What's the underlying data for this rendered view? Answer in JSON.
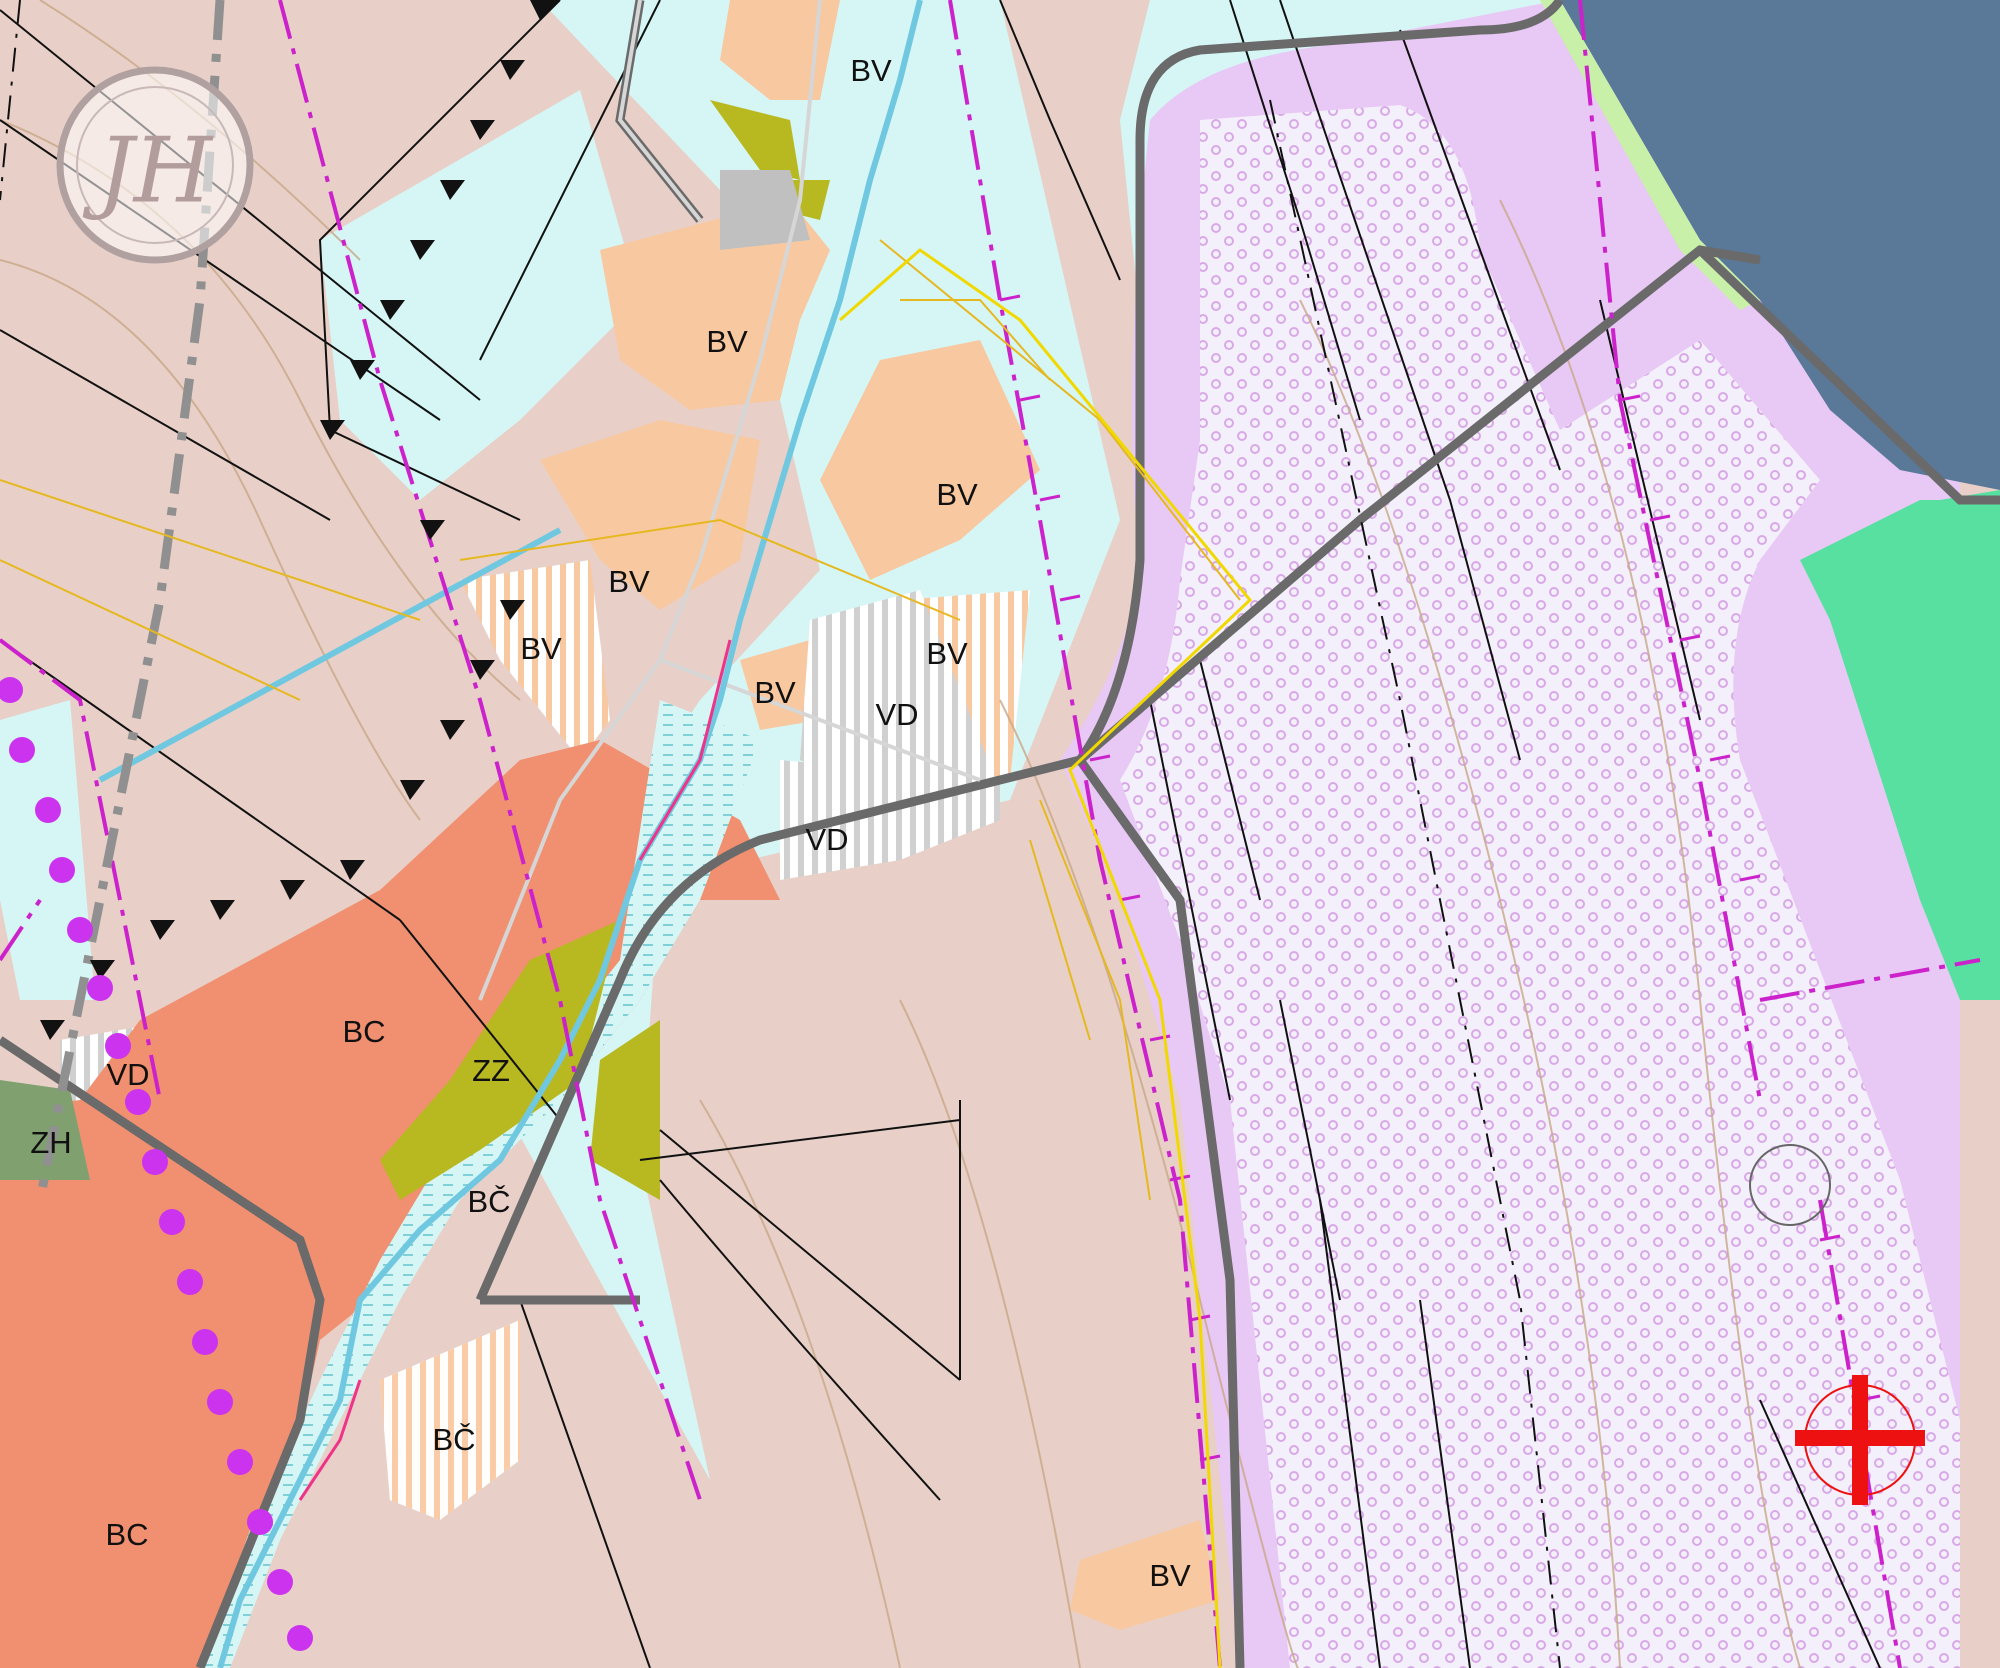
{
  "map": {
    "logo_monogram": "JH",
    "zone_labels": [
      {
        "id": "bv-1",
        "text": "BV"
      },
      {
        "id": "bv-2",
        "text": "BV"
      },
      {
        "id": "bv-3",
        "text": "BV"
      },
      {
        "id": "bv-4",
        "text": "BV"
      },
      {
        "id": "bv-5",
        "text": "BV"
      },
      {
        "id": "bv-6",
        "text": "BV"
      },
      {
        "id": "bv-7",
        "text": "BV"
      },
      {
        "id": "bv-8",
        "text": "BV"
      },
      {
        "id": "vd-1",
        "text": "VD"
      },
      {
        "id": "vd-2",
        "text": "VD"
      },
      {
        "id": "vd-3",
        "text": "VD"
      },
      {
        "id": "bc-1",
        "text": "BC"
      },
      {
        "id": "bc-2",
        "text": "BC"
      },
      {
        "id": "bc-hacek-1",
        "text": "BČ"
      },
      {
        "id": "bc-hacek-2",
        "text": "BČ"
      },
      {
        "id": "zz-1",
        "text": "ZZ"
      },
      {
        "id": "zh-1",
        "text": "ZH"
      }
    ],
    "colors": {
      "agricultural": "#e8d0c8",
      "bv_residential": "#f8c8a0",
      "bc_residential": "#f09070",
      "meadow": "#d6f6f6",
      "airfield": "#e8c8f4",
      "airfield_dots": "#d8a8e8",
      "water": "#5a7898",
      "green": "#58e0a0",
      "garden_olive": "#b8b820",
      "greenery_zh": "#80a070",
      "gray_block": "#c0c0c0",
      "stream": "#70c8e0",
      "road": "#707070",
      "boundary_magenta": "#cc22cc",
      "contour": "#c8a888",
      "utility_yellow": "#f0c020",
      "purple_dot": "#cc33ee",
      "red_cross": "#ee1111"
    }
  }
}
